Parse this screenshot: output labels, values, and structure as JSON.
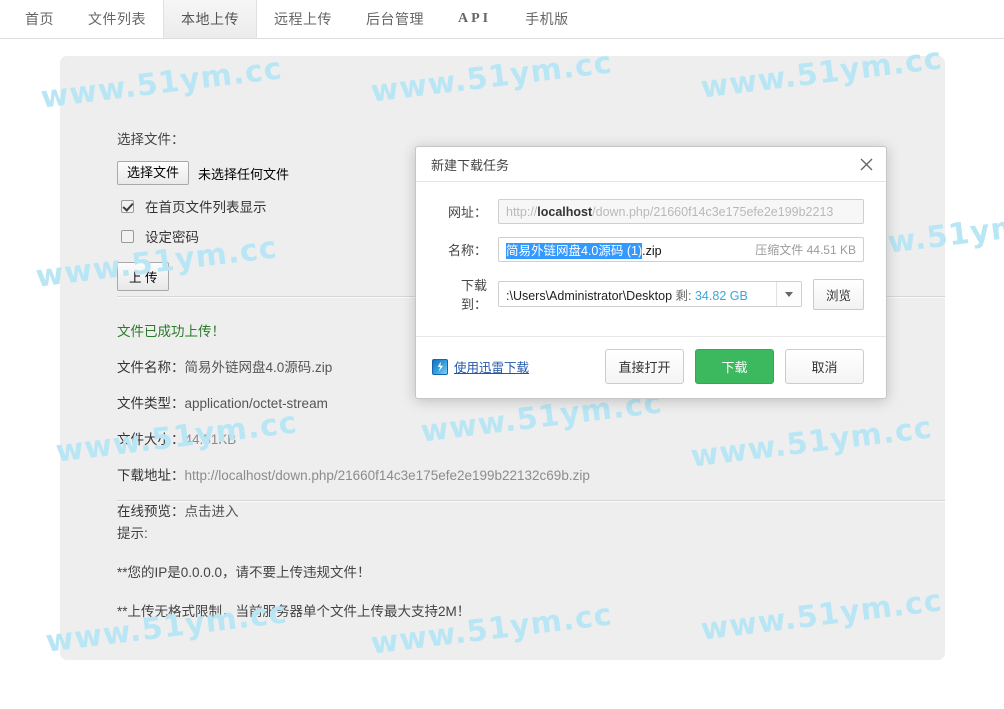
{
  "nav": {
    "items": [
      {
        "label": "首页",
        "active": false,
        "name": "nav-home"
      },
      {
        "label": "文件列表",
        "active": false,
        "name": "nav-file-list"
      },
      {
        "label": "本地上传",
        "active": true,
        "name": "nav-local-upload"
      },
      {
        "label": "远程上传",
        "active": false,
        "name": "nav-remote-upload"
      },
      {
        "label": "后台管理",
        "active": false,
        "name": "nav-admin"
      },
      {
        "label": "API",
        "active": false,
        "name": "nav-api"
      },
      {
        "label": "手机版",
        "active": false,
        "name": "nav-mobile"
      }
    ]
  },
  "watermark": {
    "text": "www.51ym.cc",
    "color": "#b9e6f5"
  },
  "form": {
    "select_file_label": "选择文件：",
    "choose_button": "选择文件",
    "no_file_text": "未选择任何文件",
    "checkbox_show_on_home": "在首页文件列表显示",
    "checkbox_set_password": "设定密码",
    "upload_button": "上 传"
  },
  "result": {
    "success_text": "文件已成功上传！",
    "success_color": "#2a7a2a",
    "rows": [
      {
        "label": "文件名称：",
        "value": "简易外链网盘4.0源码.zip"
      },
      {
        "label": "文件类型：",
        "value": "application/octet-stream"
      },
      {
        "label": "文件大小：",
        "value": "44.51KB"
      },
      {
        "label": "下载地址：",
        "value": "http://localhost/down.php/21660f14c3e175efe2e199b22132c69b.zip"
      },
      {
        "label": "在线预览：",
        "value": "点击进入"
      }
    ]
  },
  "tips": {
    "heading": "提示:",
    "lines": [
      "**您的IP是0.0.0.0，请不要上传违规文件！",
      "**上传无格式限制，当前服务器单个文件上传最大支持2M！"
    ]
  },
  "dialog": {
    "title": "新建下载任务",
    "close_icon": "close-icon",
    "url_label": "网址：",
    "url_prefix": "http://",
    "url_host": "localhost",
    "url_rest": "/down.php/21660f14c3e175efe2e199b2213",
    "name_label": "名称：",
    "name_selected": "简易外链网盘4.0源码 (1)",
    "name_extension": ".zip",
    "name_meta": "压缩文件 44.51 KB",
    "save_label": "下载到：",
    "save_path": ":\\Users\\Administrator\\Desktop",
    "save_free_prefix": "剩:",
    "save_free_value": "34.82 GB",
    "browse_button": "浏览",
    "thunder_link": "使用迅雷下载",
    "thunder_icon": "thunder-icon",
    "open_button": "直接打开",
    "download_button": "下载",
    "cancel_button": "取消",
    "primary_color": "#3cb85f",
    "selection_color": "#3399ff"
  }
}
